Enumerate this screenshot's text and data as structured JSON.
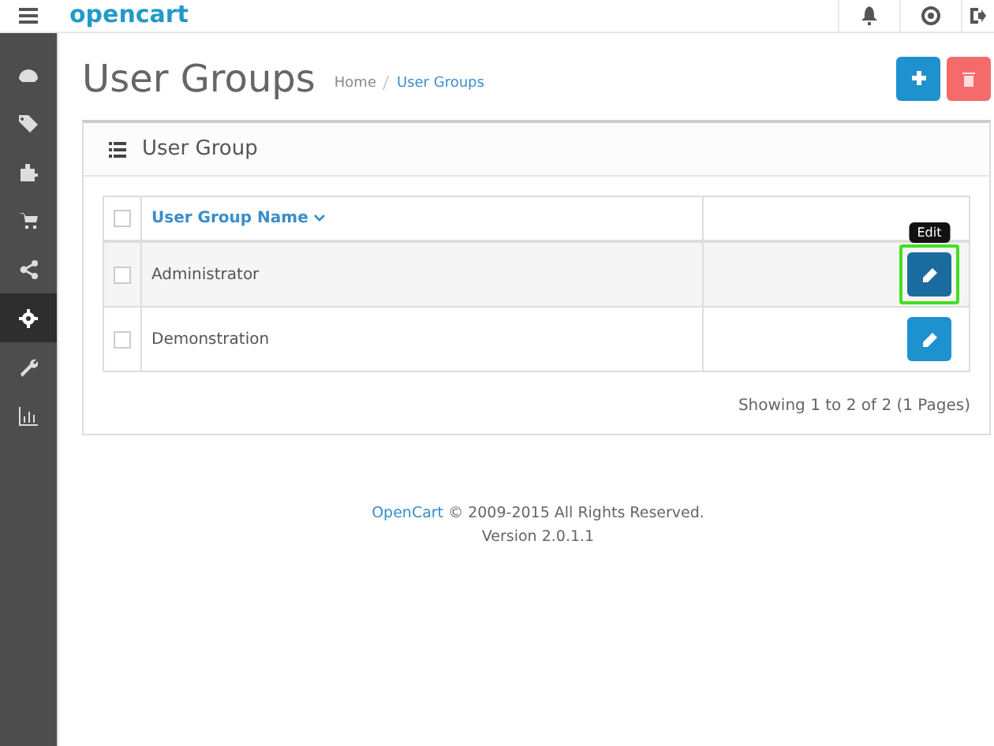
{
  "header": {
    "logo": "opencart"
  },
  "sidebar": {
    "items": [
      {
        "kind": "dashboard",
        "selected": false
      },
      {
        "kind": "tag",
        "selected": false
      },
      {
        "kind": "puzzle",
        "selected": false
      },
      {
        "kind": "cart",
        "selected": false
      },
      {
        "kind": "share",
        "selected": false
      },
      {
        "kind": "gear",
        "selected": true
      },
      {
        "kind": "wrench",
        "selected": false
      },
      {
        "kind": "chart",
        "selected": false
      }
    ]
  },
  "page": {
    "title": "User Groups",
    "breadcrumbs": [
      {
        "label": "Home",
        "current": false
      },
      {
        "label": "User Groups",
        "current": true
      }
    ]
  },
  "panel": {
    "title": "User Group",
    "table": {
      "select_all": {
        "checked": false
      },
      "columns": [
        {
          "label": "User Group Name"
        }
      ],
      "rows": [
        {
          "name": "Administrator",
          "checked": false,
          "hovered": true,
          "edit_highlighted": true,
          "tooltip": "Edit"
        },
        {
          "name": "Demonstration",
          "checked": false,
          "hovered": false,
          "edit_highlighted": false
        }
      ]
    },
    "pagination": "Showing 1 to 2 of 2 (1 Pages)"
  },
  "footer": {
    "link": "OpenCart",
    "text": "© 2009-2015 All Rights Reserved.",
    "version": "Version 2.0.1.1"
  }
}
